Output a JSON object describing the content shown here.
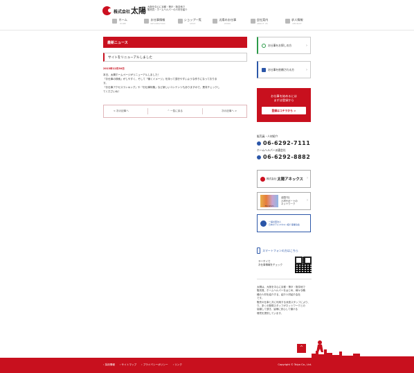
{
  "header": {
    "logo_prefix": "株式会社",
    "logo_name": "太陽",
    "tagline_1": "大阪を中心に京都・神戸・阪奈地で",
    "tagline_2": "販売員・ホームヘルパーの人材を紹介"
  },
  "nav": [
    {
      "label": "ホーム",
      "sub": "HOME",
      "icon": "home-icon"
    },
    {
      "label": "お仕事情報",
      "sub": "INFORMATION",
      "icon": "briefcase-icon"
    },
    {
      "label": "ショップ一覧",
      "sub": "SHOP",
      "icon": "shop-icon"
    },
    {
      "label": "太陽のお仕事",
      "sub": "WORK",
      "icon": "people-icon"
    },
    {
      "label": "会社案内",
      "sub": "ABOUT US",
      "icon": "building-icon"
    },
    {
      "label": "求人情報",
      "sub": "RECRUIT",
      "icon": "person-icon"
    }
  ],
  "main": {
    "section_title": "最新ニュース",
    "post_title": "サイトをリニューアルしました",
    "post_date": "2013年12月30日",
    "body": [
      "本日、太陽ホームページがリニューアルしました！",
      "「お仕事の検索」がしやすく、そして「働くイメージ」を持って頂きやすいような作りになっておりま",
      "す。",
      "「お仕事アクセスランキング」や「お仕事特集」など新しいコンテンツもありますので、是非チェックし",
      "てくださいね！"
    ],
    "pager": {
      "prev": "< 次の記事へ",
      "list": "^ 一覧に戻る",
      "next": "次の記事へ >"
    }
  },
  "sidebar": {
    "search_label": "お仕事をお探しの方",
    "company_label": "お仕事を依頼される方",
    "register_l1": "お仕事を始めるには",
    "register_l2": "まずは登録から",
    "register_button": "登録はコチラから >",
    "contact_label_1": "販売員・人材紹介",
    "contact_tel_1": "06-6292-7111",
    "contact_label_2": "ホームヘルパー派遣会社",
    "contact_tel_2": "06-6292-8882",
    "annex_prefix": "株式会社",
    "annex_name": "太陽アネックス",
    "tricom_logo": "Tricomm",
    "tricom_l1": "全国7社",
    "tricom_l2": "人材サポートの",
    "tricom_l3": "ネットワーク",
    "kyokai_l1": "一般社団法人",
    "kyokai_l2": "日本ホテルマネキン紹介事業協会",
    "sp_title": "スマートフォンの方はこちら",
    "sp_text_1": "サーチイで",
    "sp_text_2": "お仕事情報をチェック",
    "about": [
      "太陽は、大阪を中心に京都・神戸・阪奈地で",
      "販売員、ホームヘルパーをはじめ、様々な職",
      "種の人材を紹介する、紹介人材紹介会社",
      "です。",
      "販売の仕事と共に利用する派遣スタッフにより、",
      "り、多くの登録スタッフがネットワークとの",
      "協働して頂き、皆様に安心して働ける",
      "環境を提供しています。"
    ]
  },
  "footer": {
    "links": [
      "› 採用情報",
      "› サイトマップ",
      "› プライバシーポリシー",
      "› リンク"
    ],
    "copyright": "Copyright © Taiyo Co., Ltd.",
    "to_top": "^"
  },
  "colors": {
    "accent": "#c8101e",
    "blue": "#2b56a8",
    "green": "#2a9a48"
  }
}
